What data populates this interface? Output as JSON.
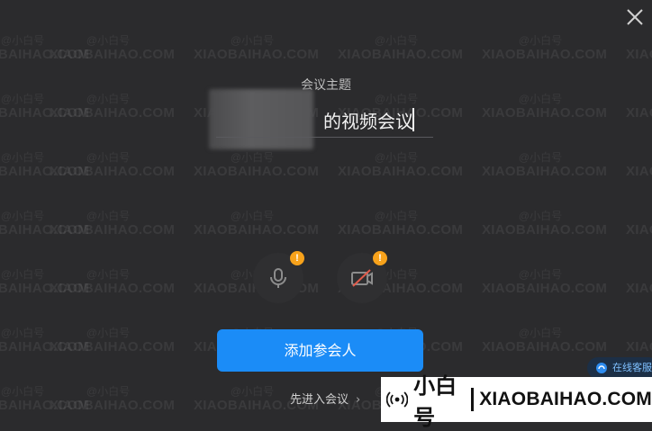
{
  "watermark": {
    "cn": "@小白号",
    "en": "XIAOBAIHAO.COM"
  },
  "dialog": {
    "close_icon": "close-icon",
    "topic_label": "会议主题",
    "topic_value": "的视频会议",
    "mic_icon": "microphone-icon",
    "camera_icon": "camera-off-icon",
    "warning_mark": "!",
    "add_participants_label": "添加参会人",
    "enter_meeting_label": "先进入会议",
    "enter_chevron": "›"
  },
  "service": {
    "label": "在线客服"
  },
  "brand": {
    "cn": "小白号",
    "en": "XIAOBAIHAO.COM"
  },
  "colors": {
    "accent": "#1b8cf7",
    "warning": "#f7a21b",
    "background": "#2b2b2d"
  }
}
